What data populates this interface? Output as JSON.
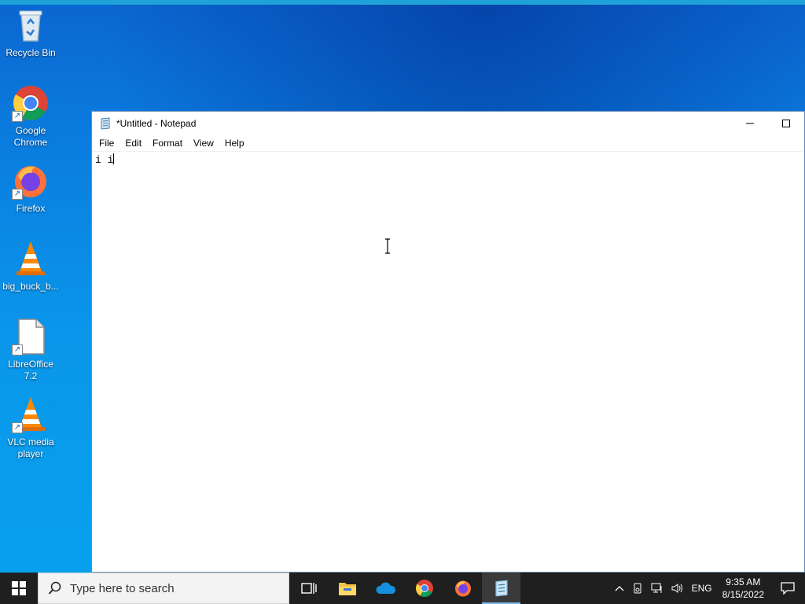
{
  "desktop": {
    "icons": [
      {
        "label": "Recycle Bin",
        "icon": "recycle-bin-icon"
      },
      {
        "label": "Google Chrome",
        "icon": "chrome-icon"
      },
      {
        "label": "Firefox",
        "icon": "firefox-icon"
      },
      {
        "label": "big_buck_b...",
        "icon": "vlc-file-icon"
      },
      {
        "label": "LibreOffice 7.2",
        "icon": "libreoffice-icon"
      },
      {
        "label": "VLC media player",
        "icon": "vlc-icon"
      }
    ]
  },
  "notepad": {
    "title": "*Untitled - Notepad",
    "menu": [
      "File",
      "Edit",
      "Format",
      "View",
      "Help"
    ],
    "content": "i i",
    "controls": {
      "minimize": "—",
      "maximize": "☐"
    }
  },
  "taskbar": {
    "search_placeholder": "Type here to search",
    "pinned": [
      "task-view-icon",
      "file-explorer-icon",
      "onedrive-icon",
      "chrome-icon",
      "firefox-icon",
      "notepad-icon"
    ],
    "active_app": "notepad-icon",
    "tray": {
      "language": "ENG",
      "time": "9:35 AM",
      "date": "8/15/2022"
    }
  },
  "colors": {
    "desktop": "#0a7ee0",
    "taskbar": "#1f1f1f",
    "accent": "#76b9ed"
  }
}
